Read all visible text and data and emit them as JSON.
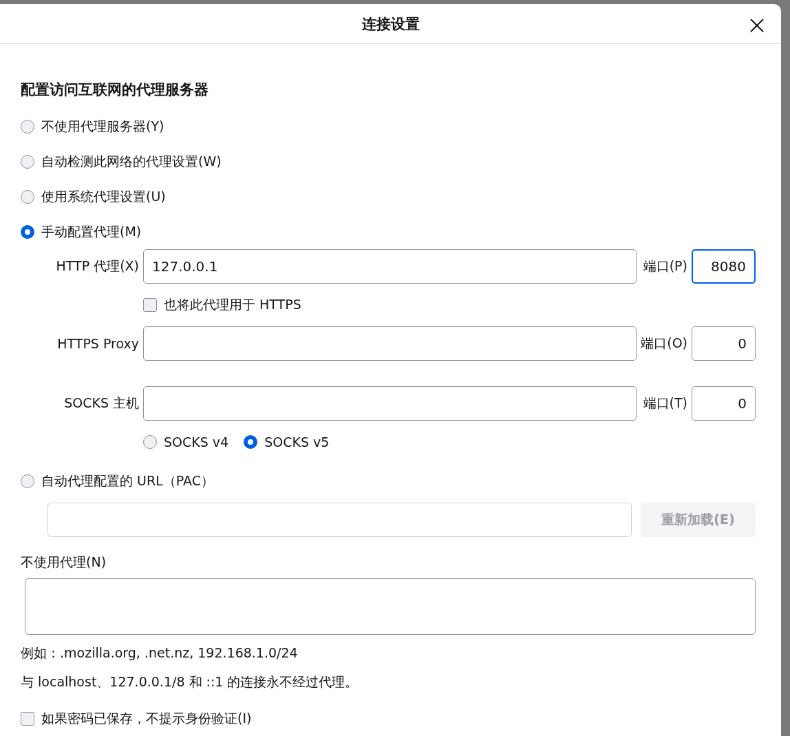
{
  "dialog": {
    "title": "连接设置"
  },
  "section_heading": "配置访问互联网的代理服务器",
  "proxy_modes": [
    {
      "kind": "none",
      "label": "不使用代理服务器(Y)",
      "selected": false
    },
    {
      "kind": "auto_detect",
      "label": "自动检测此网络的代理设置(W)",
      "selected": false
    },
    {
      "kind": "system",
      "label": "使用系统代理设置(U)",
      "selected": false
    },
    {
      "kind": "manual",
      "label": "手动配置代理(M)",
      "selected": true
    },
    {
      "kind": "pac",
      "label": "自动代理配置的 URL（PAC）",
      "selected": false
    }
  ],
  "manual": {
    "http": {
      "label": "HTTP 代理(X)",
      "value": "127.0.0.1",
      "port_label": "端口(P)",
      "port_value": "8080",
      "port_focused": true
    },
    "also_https": {
      "label": "也将此代理用于 HTTPS",
      "checked": false
    },
    "https": {
      "label": "HTTPS Proxy",
      "port_label": "端口(O)",
      "port_value": "0",
      "port_focused": false
    },
    "socks": {
      "label": "SOCKS 主机",
      "port_label": "端口(T)",
      "port_value": "0",
      "port_focused": false
    },
    "socks_versions": [
      {
        "label": "SOCKS v4",
        "selected": false
      },
      {
        "label": "SOCKS v5",
        "selected": true
      }
    ]
  },
  "pac": {
    "reload_button": {
      "label": "重新加载(E)",
      "disabled": true
    }
  },
  "no_proxy": {
    "label": "不使用代理(N)"
  },
  "example_text": "例如：.mozilla.org, .net.nz, 192.168.1.0/24",
  "note_text": "与 localhost、127.0.0.1/8 和 ::1 的连接永不经过代理。",
  "auth_checkbox": {
    "label": "如果密码已保存，不提示身份验证(I)",
    "checked": false
  }
}
